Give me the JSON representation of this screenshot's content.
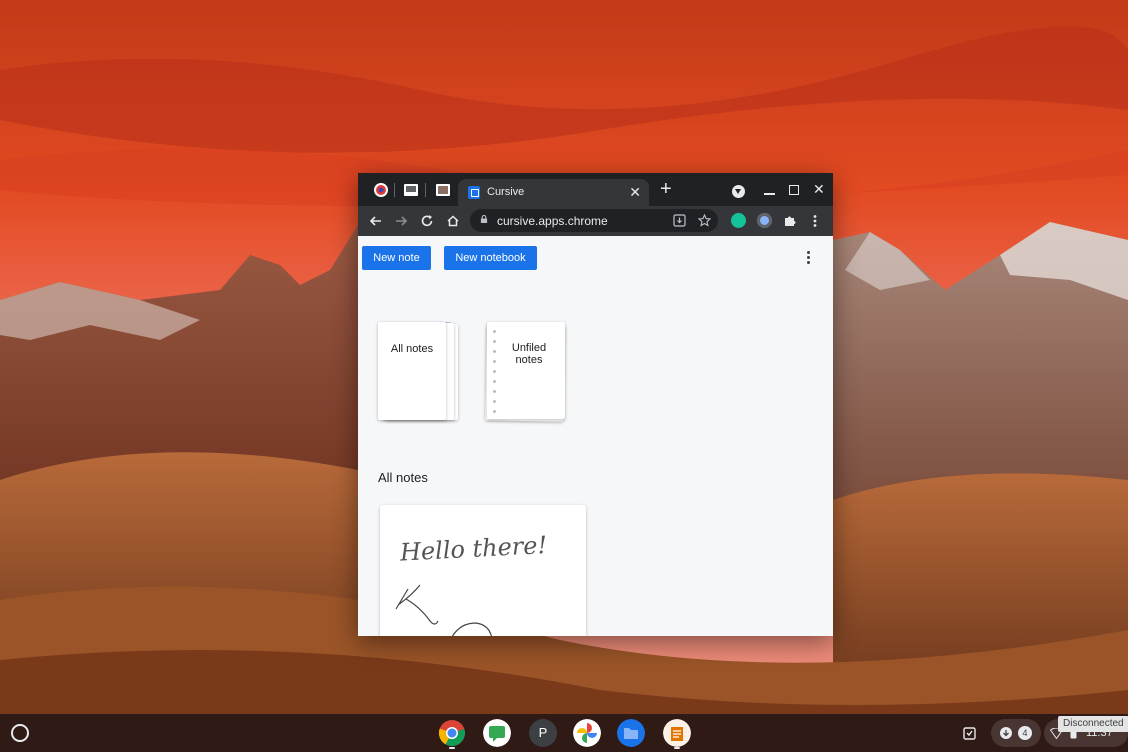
{
  "browser": {
    "tabs": {
      "pinned": [
        {
          "icon": "cast-app-icon"
        },
        {
          "icon": "slides-app-icon"
        },
        {
          "icon": "photo-app-icon"
        }
      ],
      "active": {
        "title": "Cursive",
        "close": "✕",
        "icon": "cursive-icon"
      },
      "new_tab": "+"
    },
    "window_controls": {
      "minimize": "—",
      "maximize": "▢",
      "close": "✕"
    },
    "toolbar": {
      "url": "cursive.apps.chrome"
    }
  },
  "cursive": {
    "toolbar": {
      "new_note": "New note",
      "new_notebook": "New notebook"
    },
    "notebooks": [
      {
        "label": "All notes"
      },
      {
        "label": "Unfiled notes"
      }
    ],
    "section_title": "All notes",
    "notes": [
      {
        "handwriting": "Hello there!"
      }
    ]
  },
  "shelf": {
    "apps": [
      "chrome-icon",
      "chat-icon",
      "p-app-icon",
      "photos-icon",
      "files-icon",
      "cursive-app-icon"
    ],
    "p_app_letter": "P",
    "notification_count": "4",
    "clock": "11:37",
    "tooltip": "Disconnected"
  },
  "colors": {
    "accent": "#1a73e8",
    "tab_strip": "#202124",
    "toolbar": "#35363a",
    "page_bg": "#f6f7f9"
  }
}
